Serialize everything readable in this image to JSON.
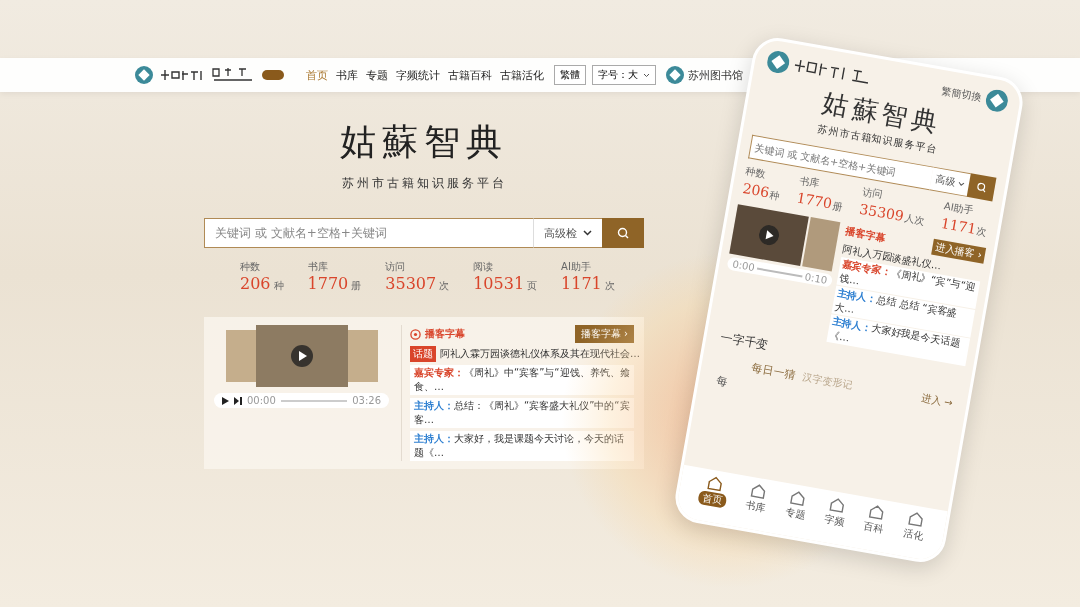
{
  "nav": {
    "items": [
      {
        "label": "首页",
        "selected": true
      },
      {
        "label": "书库",
        "selected": false
      },
      {
        "label": "专题",
        "selected": false
      },
      {
        "label": "字频统计",
        "selected": false
      },
      {
        "label": "古籍百科",
        "selected": false
      },
      {
        "label": "古籍活化",
        "selected": false
      }
    ],
    "script_button": "繁體",
    "font_size": "字号：大",
    "library": "苏州图书馆"
  },
  "hero": {
    "title": "姑蘇智典",
    "subtitle": "苏州市古籍知识服务平台"
  },
  "search": {
    "placeholder": "关键词 或 文献名+空格+关键词",
    "mode": "高级检"
  },
  "stats": [
    {
      "label": "种数",
      "value": "206",
      "unit": "种"
    },
    {
      "label": "书库",
      "value": "1770",
      "unit": "册"
    },
    {
      "label": "访问",
      "value": "35307",
      "unit": "次"
    },
    {
      "label": "阅读",
      "value": "10531",
      "unit": "页"
    },
    {
      "label": "AI助手",
      "value": "1171",
      "unit": "次"
    }
  ],
  "podcast": {
    "time": "00:00",
    "duration": "03:26",
    "title": "播客字幕",
    "enter": "播客字幕 ›",
    "tag": "话题",
    "topic": "阿礼入霖万园谈德礼仪体系及其在现代社会…",
    "lines": [
      {
        "speaker": "嘉宾专家：",
        "kind": "guest",
        "text": "《周礼》中“宾客”与“迎饯、养饩、飨食、…"
      },
      {
        "speaker": "主持人：",
        "kind": "host",
        "text": "总结：《周礼》“宾客盛大礼仪”中的“宾客…"
      },
      {
        "speaker": "主持人：",
        "kind": "host",
        "text": "大家好，我是课题今天讨论，今天的话题《…"
      }
    ]
  },
  "phone": {
    "switch": "繁簡切換",
    "title": "姑蘇智典",
    "subtitle": "苏州市古籍知识服务平台",
    "search_placeholder": "关键词 或 文献名+空格+关键词",
    "mode": "高级",
    "stats": [
      {
        "label": "种数",
        "value": "206",
        "unit": "种"
      },
      {
        "label": "书库",
        "value": "1770",
        "unit": "册"
      },
      {
        "label": "访问",
        "value": "35309",
        "unit": "人次"
      },
      {
        "label": "AI助手",
        "value": "1171",
        "unit": "次"
      }
    ],
    "time": "0:00",
    "duration": "0:10",
    "podcast_title": "播客字幕",
    "enter_podcast": "进入播客 ›",
    "topic": "阿礼入万园谈盛礼仪…",
    "lines": [
      {
        "speaker": "嘉宾专家：",
        "kind": "guest",
        "text": "《周礼》“宾”与“迎饯…"
      },
      {
        "speaker": "主持人：",
        "kind": "host",
        "text": "总结 总结 “宾客盛大…"
      },
      {
        "speaker": "主持人：",
        "kind": "host",
        "text": "大家好我是今天话题《…"
      }
    ],
    "section": "一字千变",
    "daily": "每日一猜",
    "daily_sub": "汉字变形记",
    "enter": "进入 →",
    "cut": "每",
    "tabs": [
      {
        "label": "首页",
        "selected": true
      },
      {
        "label": "书库",
        "selected": false
      },
      {
        "label": "专题",
        "selected": false
      },
      {
        "label": "字频",
        "selected": false
      },
      {
        "label": "百科",
        "selected": false
      },
      {
        "label": "活化",
        "selected": false
      }
    ]
  }
}
